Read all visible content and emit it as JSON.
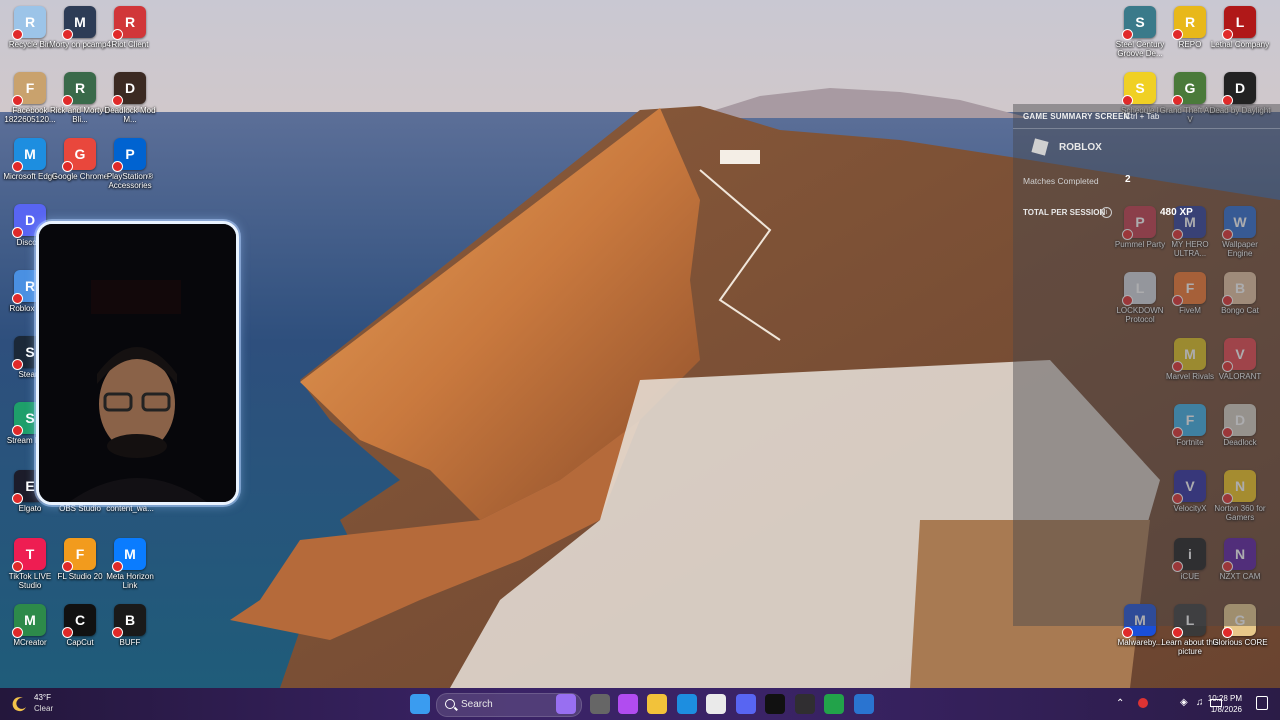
{
  "desktop": {
    "left_icons": [
      {
        "label": "Recycle Bin",
        "icon": "recycle-bin-icon",
        "color": "#9cc4e8"
      },
      {
        "label": "Morty on pcamp4",
        "icon": "video-file-icon",
        "color": "#2d3c56"
      },
      {
        "label": "Riot Client",
        "icon": "riot-icon",
        "color": "#d13639"
      },
      {
        "label": "Facebook 1822605120...",
        "icon": "image-file-icon",
        "color": "#c9a26d"
      },
      {
        "label": "Rick and Morty 3 Bli...",
        "icon": "video-file-icon",
        "color": "#3a6a4a"
      },
      {
        "label": "Deadlock Mod M...",
        "icon": "deadlock-mod-icon",
        "color": "#3b2a22"
      },
      {
        "label": "Microsoft Edge",
        "icon": "edge-icon",
        "color": "#1d8ee0"
      },
      {
        "label": "Google Chrome",
        "icon": "chrome-icon",
        "color": "#e9473c"
      },
      {
        "label": "PlayStation® Accessories",
        "icon": "playstation-icon",
        "color": "#0063d1"
      },
      {
        "label": "Disco...",
        "icon": "discord-icon",
        "color": "#5865f2"
      },
      {
        "label": "Roblox Pl...",
        "icon": "roblox-icon",
        "color": "#4a90e2"
      },
      {
        "label": "Steam",
        "icon": "steam-icon",
        "color": "#1b2838"
      },
      {
        "label": "Stream Deck",
        "icon": "stream-deck-icon",
        "color": "#1e9f6a"
      },
      {
        "label": "Elgato",
        "icon": "elgato-icon",
        "color": "#1c1c2a"
      },
      {
        "label": "OBS Studio",
        "icon": "obs-icon",
        "color": "#302e31"
      },
      {
        "label": "content_wa...",
        "icon": "file-icon",
        "color": "#555"
      },
      {
        "label": "TikTok LIVE Studio",
        "icon": "tiktok-icon",
        "color": "#ee1d52"
      },
      {
        "label": "FL Studio 20",
        "icon": "fl-studio-icon",
        "color": "#f29b1d"
      },
      {
        "label": "Meta Horizon Link",
        "icon": "meta-icon",
        "color": "#0a7cff"
      },
      {
        "label": "MCreator",
        "icon": "mcreator-icon",
        "color": "#2d8a4a"
      },
      {
        "label": "CapCut",
        "icon": "capcut-icon",
        "color": "#111"
      },
      {
        "label": "BUFF",
        "icon": "buff-icon",
        "color": "#1a1a1a"
      }
    ],
    "right_icons": [
      {
        "label": "Steel Century Groove De...",
        "icon": "steel-century-icon",
        "color": "#3a7a8a"
      },
      {
        "label": "REPO",
        "icon": "repo-icon",
        "color": "#e8b81a"
      },
      {
        "label": "Lethal Company",
        "icon": "lethal-company-icon",
        "color": "#b01818"
      },
      {
        "label": "Schedule I",
        "icon": "schedule-icon",
        "color": "#f0d024"
      },
      {
        "label": "Grand Theft Auto V",
        "icon": "gta-icon",
        "color": "#4a7a3a"
      },
      {
        "label": "Dead by Daylight",
        "icon": "dbd-icon",
        "color": "#222"
      },
      {
        "label": "Pummel Party",
        "icon": "pummel-party-icon",
        "color": "#c43a4a"
      },
      {
        "label": "MY HERO ULTRA...",
        "icon": "my-hero-icon",
        "color": "#2c3d9a"
      },
      {
        "label": "Wallpaper Engine",
        "icon": "wallpaper-engine-icon",
        "color": "#2a6ad0"
      },
      {
        "label": "LOCKDOWN Protocol",
        "icon": "lockdown-icon",
        "color": "#d4d8de"
      },
      {
        "label": "FiveM",
        "icon": "fivem-icon",
        "color": "#f4762a"
      },
      {
        "label": "Bongo Cat",
        "icon": "bongo-cat-icon",
        "color": "#e8c4a0"
      },
      {
        "label": "Marvel Rivals",
        "icon": "marvel-rivals-icon",
        "color": "#e0c21a"
      },
      {
        "label": "VALORANT",
        "icon": "valorant-icon",
        "color": "#e8434a"
      },
      {
        "label": "Fortnite",
        "icon": "fortnite-icon",
        "color": "#3ab0e8"
      },
      {
        "label": "Deadlock",
        "icon": "deadlock-icon",
        "color": "#d8d0c4"
      },
      {
        "label": "VelocityX",
        "icon": "velocityx-icon",
        "color": "#2a2aa0"
      },
      {
        "label": "Norton 360 for Gamers",
        "icon": "norton-icon",
        "color": "#f2c51a"
      },
      {
        "label": "iCUE",
        "icon": "icue-icon",
        "color": "#1c1c1c"
      },
      {
        "label": "NZXT CAM",
        "icon": "nzxt-icon",
        "color": "#5a1aa0"
      },
      {
        "label": "Malwareby...",
        "icon": "malwarebytes-icon",
        "color": "#1a4fd8"
      },
      {
        "label": "Learn about this picture",
        "icon": "camera-icon",
        "color": "#3a3a3a"
      },
      {
        "label": "Glorious CORE",
        "icon": "glorious-icon",
        "color": "#e8c88a"
      }
    ]
  },
  "overlay": {
    "header": "GAME SUMMARY SCREEN",
    "hotkey": "Ctrl + Tab",
    "game": "ROBLOX",
    "matches_label": "Matches Completed",
    "matches_value": "2",
    "total_label": "TOTAL PER SESSION",
    "info": "i",
    "xp": "480 XP"
  },
  "taskbar": {
    "weather_temp": "43°F",
    "weather_cond": "Clear",
    "search_label": "Search",
    "time": "10:28 PM",
    "date": "1/8/2026",
    "apps": [
      {
        "icon": "windows-start-icon",
        "color": "#3a9cf0"
      },
      {
        "icon": "copilot-icon",
        "color": "#8a5cf0"
      },
      {
        "icon": "task-view-icon",
        "color": "#666"
      },
      {
        "icon": "copilot-app-icon",
        "color": "#b14cf0"
      },
      {
        "icon": "file-explorer-icon",
        "color": "#f2c23a"
      },
      {
        "icon": "edge-icon",
        "color": "#1d8ee0"
      },
      {
        "icon": "store-icon",
        "color": "#eaeaea"
      },
      {
        "icon": "discord-icon",
        "color": "#5865f2"
      },
      {
        "icon": "terminal-icon",
        "color": "#111"
      },
      {
        "icon": "obs-icon",
        "color": "#302e31"
      },
      {
        "icon": "xbox-icon",
        "color": "#22a34a"
      },
      {
        "icon": "snipping-icon",
        "color": "#2a74d0"
      }
    ]
  }
}
